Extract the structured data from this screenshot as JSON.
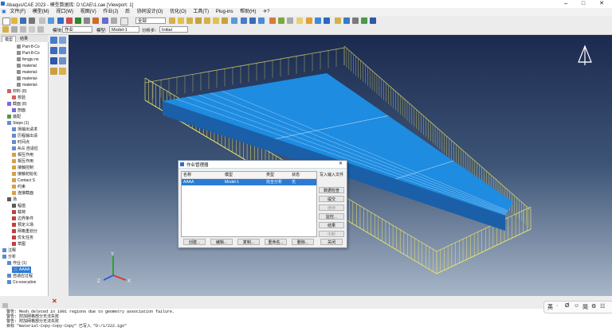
{
  "window": {
    "title": "Abaqus/CAE 2023 - 模型数据库: D:\\CAE\\1.cae [Viewport: 1]"
  },
  "menu": [
    "文件(F)",
    "模型(M)",
    "视口(W)",
    "视图(V)",
    "作业(J)",
    "后",
    "协同设计(O)",
    "优化(O)",
    "工具(T)",
    "Plug-ins",
    "帮助(H)",
    "✈?"
  ],
  "toolbar": {
    "render_select": "全部"
  },
  "context_bar": {
    "module_label": "模块:",
    "module_value": "作业",
    "model_label": "模型:",
    "model_value": "Model-1",
    "step_label": "分析步:",
    "step_value": "Initial"
  },
  "tree_tabs": [
    "模型",
    "结果"
  ],
  "tree": [
    {
      "label": "Part-8-Co",
      "indent": 3,
      "icon": "#8e8e8e"
    },
    {
      "label": "Part-8-Co",
      "indent": 3,
      "icon": "#8e8e8e"
    },
    {
      "label": "fengju no",
      "indent": 3,
      "icon": "#8e8e8e"
    },
    {
      "label": "material",
      "indent": 3,
      "icon": "#8e8e8e"
    },
    {
      "label": "material-",
      "indent": 3,
      "icon": "#8e8e8e"
    },
    {
      "label": "material-",
      "indent": 3,
      "icon": "#8e8e8e"
    },
    {
      "label": "material-",
      "indent": 3,
      "icon": "#8e8e8e"
    },
    {
      "label": "材料 (8)",
      "indent": 1,
      "icon": "#d45d5d"
    },
    {
      "label": "校验",
      "indent": 2,
      "icon": "#d45d5d"
    },
    {
      "label": "截面 (8)",
      "indent": 1,
      "icon": "#7a6ad0"
    },
    {
      "label": "剖面",
      "indent": 2,
      "icon": "#7a6ad0"
    },
    {
      "label": "装配",
      "indent": 1,
      "icon": "#4a9a4a"
    },
    {
      "label": "Steps (1)",
      "indent": 1,
      "icon": "#6a8acb"
    },
    {
      "label": "场输出请求",
      "indent": 2,
      "icon": "#6a8acb"
    },
    {
      "label": "历程输出请",
      "indent": 2,
      "icon": "#6a8acb"
    },
    {
      "label": "时间点",
      "indent": 2,
      "icon": "#6a8acb"
    },
    {
      "label": "ALE 自适应",
      "indent": 2,
      "icon": "#6a8acb"
    },
    {
      "label": "相互作用",
      "indent": 2,
      "icon": "#d4a04a"
    },
    {
      "label": "相互作用",
      "indent": 2,
      "icon": "#d4a04a"
    },
    {
      "label": "接触控制",
      "indent": 2,
      "icon": "#d4a04a"
    },
    {
      "label": "接触初始化",
      "indent": 2,
      "icon": "#d4a04a"
    },
    {
      "label": "Contact S",
      "indent": 2,
      "icon": "#d4a04a"
    },
    {
      "label": "约束",
      "indent": 2,
      "icon": "#d4a04a"
    },
    {
      "label": "连接截面",
      "indent": 2,
      "icon": "#d4a04a"
    },
    {
      "label": "场",
      "indent": 1,
      "icon": "#5a5a5a"
    },
    {
      "label": "幅值",
      "indent": 2,
      "icon": "#5a5a5a"
    },
    {
      "label": "载荷",
      "indent": 2,
      "icon": "#c04040"
    },
    {
      "label": "边界条件",
      "indent": 2,
      "icon": "#c04040"
    },
    {
      "label": "预定义场",
      "indent": 2,
      "icon": "#c04040"
    },
    {
      "label": "网格重划分",
      "indent": 2,
      "icon": "#c04040"
    },
    {
      "label": "优化任务",
      "indent": 2,
      "icon": "#c04040"
    },
    {
      "label": "草图",
      "indent": 2,
      "icon": "#c04040"
    },
    {
      "label": "注释",
      "indent": 0,
      "icon": "#5a8acb"
    },
    {
      "label": "分析",
      "indent": 0,
      "icon": "#5a8acb"
    },
    {
      "label": "作业 (1)",
      "indent": 1,
      "icon": "#5a8acb"
    },
    {
      "label": "AAAA",
      "indent": 2,
      "icon": "#5a8acb",
      "selected": true
    },
    {
      "label": "自适应过程",
      "indent": 1,
      "icon": "#5a8acb"
    },
    {
      "label": "Co-execution",
      "indent": 1,
      "icon": "#5a8acb"
    }
  ],
  "dialog": {
    "title": "作业管理器",
    "columns": [
      "名称",
      "模型",
      "类型",
      "状态"
    ],
    "rows": [
      {
        "name": "AAAA",
        "model": "Model-1",
        "type": "完全分析",
        "status": "无"
      }
    ],
    "side_buttons": [
      {
        "label": "写入输入文件",
        "enabled": true
      },
      {
        "label": "数据检查",
        "enabled": true
      },
      {
        "label": "提交",
        "enabled": true
      },
      {
        "label": "继续",
        "enabled": false
      },
      {
        "label": "监控...",
        "enabled": true
      },
      {
        "label": "结果",
        "enabled": true
      },
      {
        "label": "中断",
        "enabled": false
      }
    ],
    "bottom_buttons": [
      "创建...",
      "编辑...",
      "复制...",
      "重命名...",
      "删除...",
      "关闭"
    ]
  },
  "triad": {
    "x": "X",
    "y": "Y",
    "z": "Z"
  },
  "messages": [
    "警告: Mesh deleted in 1991 regions due to geometry association failure.",
    "警告: 附加网格部分无法失败",
    "警告: 附加网格部分无法失败",
    "目标 \"material-Copy-Copy-Copy\" 已写入 \"D:/1/222.igs\""
  ],
  "ime": [
    "英",
    "·",
    "Ø",
    "☺",
    "简",
    "⚙",
    "☷"
  ],
  "colors": {
    "plate": "#1e8ce0",
    "plate_side": "#1a5fa8",
    "mesh_lines": "#e8e26a",
    "selection": "#2b7bd6"
  }
}
